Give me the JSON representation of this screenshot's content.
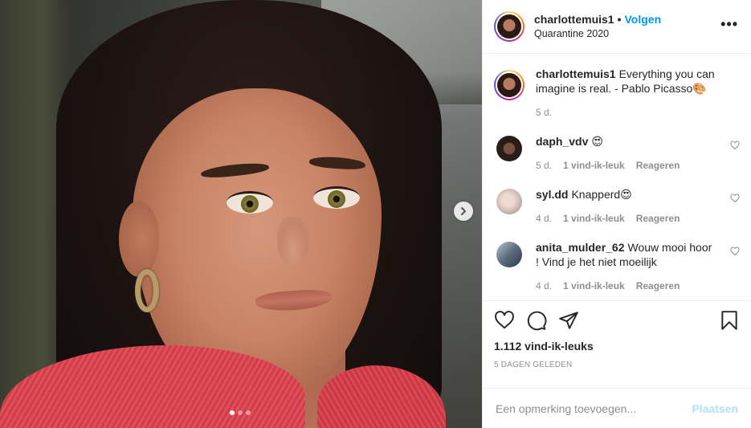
{
  "header": {
    "username": "charlottemuis1",
    "separator": "•",
    "follow_label": "Volgen",
    "location": "Quarantine 2020",
    "more_icon": "ellipsis-icon"
  },
  "caption": {
    "username": "charlottemuis1",
    "text": "Everything you can imagine is real. - Pablo Picasso🎨",
    "time": "5 d."
  },
  "comments": [
    {
      "username": "daph_vdv",
      "text": "😍",
      "time": "5 d.",
      "likes": "1 vind-ik-leuk",
      "reply": "Reageren"
    },
    {
      "username": "syl.dd",
      "text": "Knapperd😍",
      "time": "4 d.",
      "likes": "1 vind-ik-leuk",
      "reply": "Reageren"
    },
    {
      "username": "anita_mulder_62",
      "text": "Wouw mooi hoor ! Vind je het niet moeilijk",
      "time": "4 d.",
      "likes": "1 vind-ik-leuk",
      "reply": "Reageren"
    }
  ],
  "actions": {
    "like_icon": "heart-icon",
    "comment_icon": "comment-icon",
    "share_icon": "paper-plane-icon",
    "save_icon": "bookmark-icon",
    "likes_count": "1.112 vind-ik-leuks",
    "posted_ago": "5 DAGEN GELEDEN"
  },
  "add_comment": {
    "placeholder": "Een opmerking toevoegen...",
    "submit_label": "Plaatsen"
  },
  "carousel": {
    "slide_count": 3,
    "active_index": 0
  },
  "colors": {
    "accent": "#0095f6",
    "post_disabled": "#b2dffc",
    "secondary_text": "#8e8e8e",
    "border": "#efefef"
  }
}
